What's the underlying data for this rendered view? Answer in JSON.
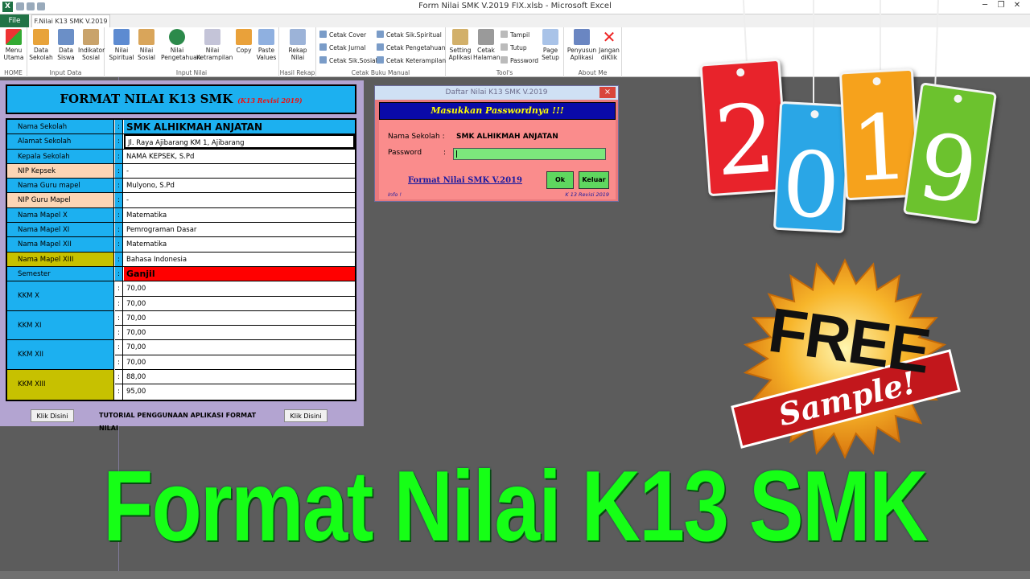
{
  "window": {
    "title": "Form Nilai SMK V.2019 FIX.xlsb  -  Microsoft Excel",
    "app_icon": "X"
  },
  "tabs": {
    "file": "File",
    "active": "F.Nilai K13 SMK V.2019"
  },
  "ribbon": {
    "groups": {
      "home": "HOME",
      "input_data": "Input Data",
      "input_nilai": "Input Nilai",
      "hasil_rekap": "Hasil Rekap",
      "cetak_buku_manual": "Cetak Buku Manual",
      "tools": "Tool's",
      "about_me": "About Me"
    },
    "buttons": {
      "menu_utama": "Menu Utama",
      "data_sekolah": "Data Sekolah",
      "data_siswa": "Data Siswa",
      "indikator_sosial": "Indikator Sosial",
      "nilai_spiritual": "Nilai Spiritual",
      "nilai_sosial": "Nilai Sosial",
      "nilai_pengetahuan": "Nilai Pengetahuan",
      "nilai_ketrampilan": "Nilai Ketrampilan",
      "copy": "Copy",
      "paste_values": "Paste Values",
      "rekap_nilai": "Rekap Nilai",
      "cetak_cover": "Cetak Cover",
      "cetak_jurnal": "Cetak Jurnal",
      "cetak_sik_sosial": "Cetak Sik.Sosial",
      "cetak_sik_spiritual": "Cetak Sik.Spiritual",
      "cetak_pengetahuan": "Cetak Pengetahuan",
      "cetak_keterampilan": "Cetak Keterampilan",
      "setting_aplikasi": "Setting Aplikasi",
      "cetak_halaman": "Cetak Halaman",
      "tampil": "Tampil",
      "tutup": "Tutup",
      "password": "Password",
      "page_setup": "Page Setup",
      "penyusun_aplikasi": "Penyusun Aplikasi",
      "jangan_diklik": "Jangan diKlik"
    }
  },
  "form": {
    "title": "FORMAT NILAI K13 SMK",
    "subtitle": "(K13 Revisi 2019)",
    "rows": [
      {
        "label": "Nama Sekolah",
        "value": "SMK ALHIKMAH ANJATAN"
      },
      {
        "label": "Alamat Sekolah",
        "value": "Jl. Raya Ajibarang KM 1, Ajibarang"
      },
      {
        "label": "Kepala Sekolah",
        "value": "NAMA KEPSEK, S.Pd"
      },
      {
        "label": "NIP Kepsek",
        "value": "-"
      },
      {
        "label": "Nama Guru mapel",
        "value": "Mulyono, S.Pd"
      },
      {
        "label": "NIP Guru Mapel",
        "value": "-"
      },
      {
        "label": "Nama Mapel X",
        "value": "Matematika"
      },
      {
        "label": "Nama Mapel XI",
        "value": "Pemrograman Dasar"
      },
      {
        "label": "Nama Mapel XII",
        "value": "Matematika"
      },
      {
        "label": "Nama Mapel XIII",
        "value": "Bahasa Indonesia"
      },
      {
        "label": "Semester",
        "value": "Ganjil"
      }
    ],
    "kkm": [
      {
        "label": "KKM X",
        "values": [
          "70,00",
          "70,00"
        ]
      },
      {
        "label": "KKM XI",
        "values": [
          "70,00",
          "70,00"
        ]
      },
      {
        "label": "KKM XII",
        "values": [
          "70,00",
          "70,00"
        ]
      },
      {
        "label": "KKM XIII",
        "values": [
          "88,00",
          "95,00"
        ]
      }
    ],
    "colon": ":",
    "klik_left": "Klik Disini",
    "tutorial": "TUTORIAL PENGGUNAAN APLIKASI FORMAT NILAI",
    "klik_right": "Klik Disini"
  },
  "dialog": {
    "title": "Daftar Nilai K13 SMK V.2019",
    "close": "×",
    "banner": "Masukkan Passwordnya !!!",
    "school_label": "Nama Sekolah  :",
    "school_value": "SMK ALHIKMAH ANJATAN",
    "password_label": "Password",
    "password_colon": ":",
    "password_value": "",
    "link": "Format Nilai SMK V.2019",
    "ok": "Ok",
    "keluar": "Keluar",
    "info": "Info !",
    "revisi": "K 13 Revisi 2019"
  },
  "decor": {
    "year_digits": [
      "2",
      "0",
      "1",
      "9"
    ],
    "year_colors": [
      "#e8232b",
      "#2aa6e6",
      "#f6a21c",
      "#6cc22e"
    ],
    "free": "FREE",
    "sample": "Sample!",
    "big_title": "Format Nilai K13 SMK",
    "title_color": "#16ff16"
  }
}
